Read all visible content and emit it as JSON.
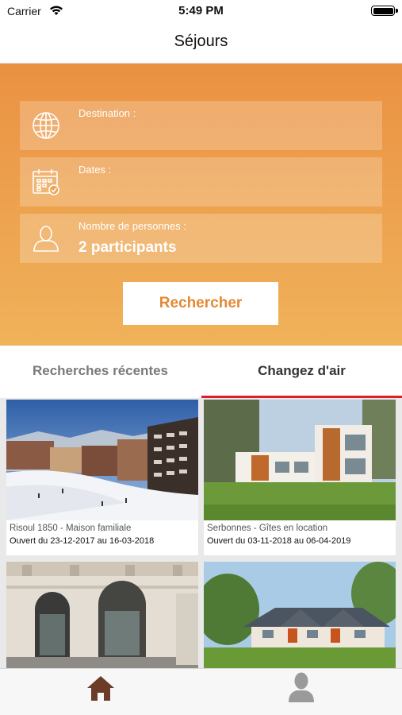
{
  "status_bar": {
    "carrier": "Carrier",
    "time": "5:49 PM"
  },
  "nav": {
    "title": "Séjours"
  },
  "search": {
    "destination_label": "Destination :",
    "destination_value": "",
    "dates_label": "Dates :",
    "dates_value": "",
    "people_label": "Nombre de personnes :",
    "people_value": "2 participants",
    "button_label": "Rechercher"
  },
  "tabs": [
    {
      "label": "Recherches récentes",
      "selected": false
    },
    {
      "label": "Changez d'air",
      "selected": true
    }
  ],
  "cards": [
    {
      "title": "Risoul 1850 - Maison familiale",
      "dates": "Ouvert du 23-12-2017 au 16-03-2018"
    },
    {
      "title": "Serbonnes - Gîtes en location",
      "dates": "Ouvert du 03-11-2018 au 06-04-2019"
    },
    {
      "title": "",
      "dates": ""
    },
    {
      "title": "",
      "dates": ""
    }
  ],
  "bottom_tabs": [
    {
      "icon": "home-icon",
      "selected": true
    },
    {
      "icon": "profile-icon",
      "selected": false
    }
  ],
  "colors": {
    "accent_orange": "#e38a35",
    "gradient_top": "#ea9142",
    "gradient_bottom": "#f0b25a",
    "tab_underline": "#e01e2a",
    "home_icon": "#6b3d28",
    "profile_icon": "#9a9a9a"
  }
}
